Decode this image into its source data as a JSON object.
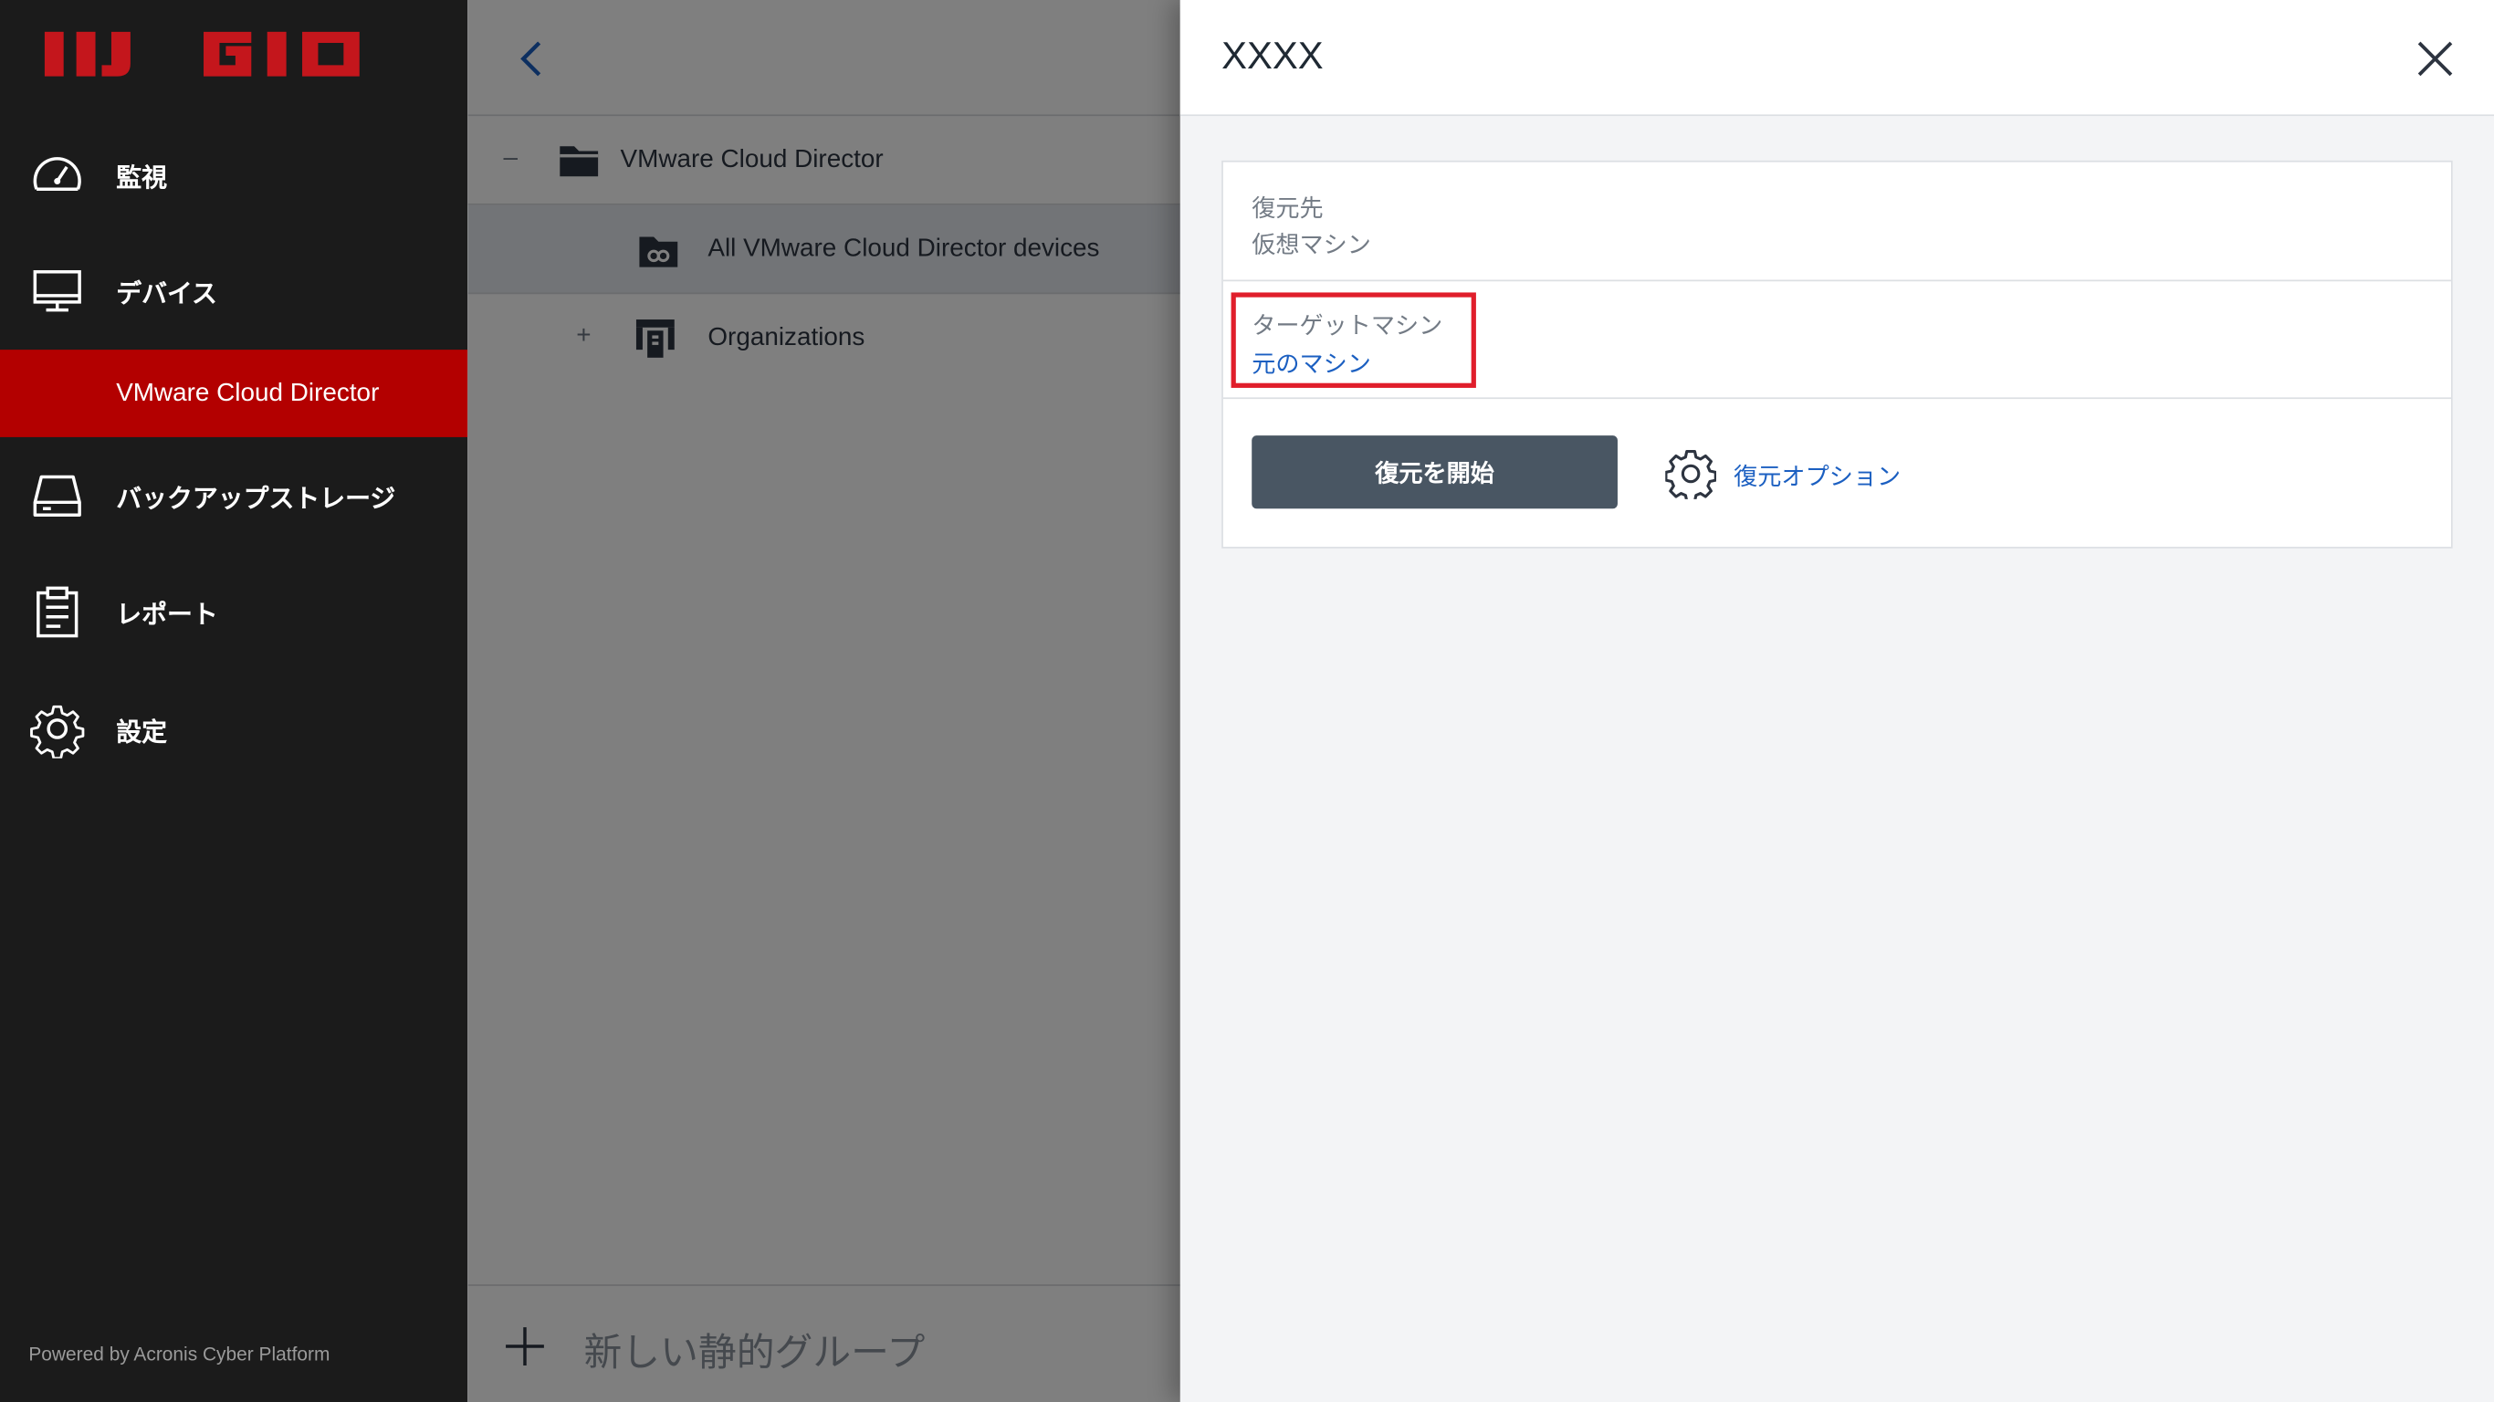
{
  "sidebar": {
    "logo_text": "IIJ GIO",
    "items": [
      {
        "label": "監視",
        "icon": "dashboard-icon"
      },
      {
        "label": "デバイス",
        "icon": "monitor-icon"
      },
      {
        "label": "VMware Cloud Director",
        "icon": "",
        "active": true
      },
      {
        "label": "バックアップストレージ",
        "icon": "storage-icon"
      },
      {
        "label": "レポート",
        "icon": "report-icon"
      },
      {
        "label": "設定",
        "icon": "gear-icon"
      }
    ],
    "powered_by": "Powered by Acronis Cyber Platform"
  },
  "middle": {
    "tree": [
      {
        "label": "VMware Cloud Director",
        "toggle": "–",
        "icon": "folder-icon"
      },
      {
        "label": "All VMware Cloud Director devices",
        "toggle": "",
        "icon": "dynamic-folder-icon"
      },
      {
        "label": "Organizations",
        "toggle": "+",
        "icon": "organizations-icon"
      }
    ],
    "new_group_label": "新しい静的グループ"
  },
  "drawer": {
    "title": "XXXX",
    "restore_to": {
      "label": "復元先",
      "value": "仮想マシン"
    },
    "target_machine": {
      "label": "ターゲットマシン",
      "value": "元のマシン"
    },
    "start_button": "復元を開始",
    "options_link": "復元オプション"
  },
  "colors": {
    "sidebar_bg": "#1b1b1b",
    "active_item": "#b30000",
    "logo_red": "#c4161c",
    "primary_button": "#495663",
    "link_blue": "#1b5fc1",
    "highlight_red": "#e01e2b"
  }
}
